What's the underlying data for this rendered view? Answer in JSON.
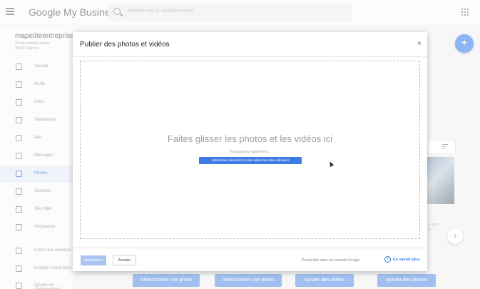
{
  "app": {
    "brand": "Google My Business",
    "search_placeholder": "Rechercher un établissement"
  },
  "business": {
    "name": "mapetiteentreprise",
    "address_line1": "25 rue frederic chopin",
    "address_line2": "26000 Valence"
  },
  "sidebar": {
    "items": [
      {
        "label": "Accueil",
        "icon": "home-dashboard-icon"
      },
      {
        "label": "Posts",
        "icon": "posts-icon"
      },
      {
        "label": "Infos",
        "icon": "store-info-icon"
      },
      {
        "label": "Statistiques",
        "icon": "bar-chart-icon"
      },
      {
        "label": "Avis",
        "icon": "reviews-icon"
      },
      {
        "label": "Messages",
        "icon": "messages-icon"
      },
      {
        "label": "Photos",
        "icon": "photos-icon"
      },
      {
        "label": "Services",
        "icon": "services-list-icon"
      },
      {
        "label": "Site Web",
        "icon": "website-icon"
      },
      {
        "label": "Utilisateurs",
        "icon": "add-user-icon"
      },
      {
        "label": "Créer une annonce",
        "icon": "ads-icon"
      },
      {
        "label": "Compte Gmail pers",
        "icon": "gmail-icon"
      },
      {
        "label": "Ajouter un établissement",
        "icon": "add-location-icon"
      }
    ],
    "active": "Photos"
  },
  "background": {
    "fab_label": "+",
    "next_arrow": "›",
    "side_text_1": "s votre",
    "side_text_2": "ie",
    "bottom_buttons": [
      "Sélectionner une photo",
      "Sélectionner une photo",
      "Ajouter des vidéos",
      "Ajouter des photos"
    ]
  },
  "dialog": {
    "title": "Publier des photos et vidéos",
    "close": "×",
    "drop_title": "Faites glisser les photos et les vidéos ici",
    "drop_sub": "Vous pouvez également...",
    "drop_select": "Sélectionner des photos et des vidéos sur votre ordinateur",
    "select_button": "Sélectionner",
    "cancel_button": "Annuler",
    "footer_note": "Post public dans les produits Google",
    "help_glyph": "?",
    "learn_more": "En savoir plus"
  },
  "colors": {
    "accent": "#3d7be6",
    "active_nav_bg": "#e8eef7"
  }
}
